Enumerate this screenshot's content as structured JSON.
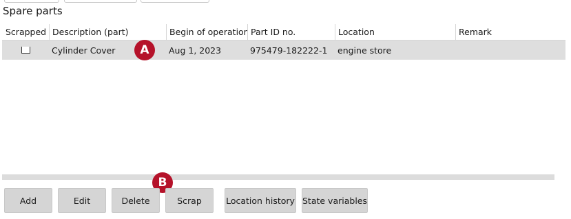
{
  "section_title": "Spare parts",
  "table": {
    "columns": [
      "Scrapped",
      "Description (part)",
      "Begin of operation",
      "Part ID no.",
      "Location",
      "Remark"
    ],
    "rows": [
      {
        "scrapped": false,
        "description": "Cylinder Cover",
        "begin_of_operation": "Aug 1, 2023",
        "part_id": "975479-182222-1",
        "location": "engine store",
        "remark": ""
      }
    ]
  },
  "markers": {
    "a": "A",
    "b": "B"
  },
  "buttons": {
    "add": "Add",
    "edit": "Edit",
    "delete": "Delete",
    "scrap": "Scrap",
    "location_history": "Location history",
    "state_variables": "State variables"
  },
  "colors": {
    "marker": "#b5122a",
    "row_selected": "#dedede",
    "button": "#d5d5d5"
  }
}
